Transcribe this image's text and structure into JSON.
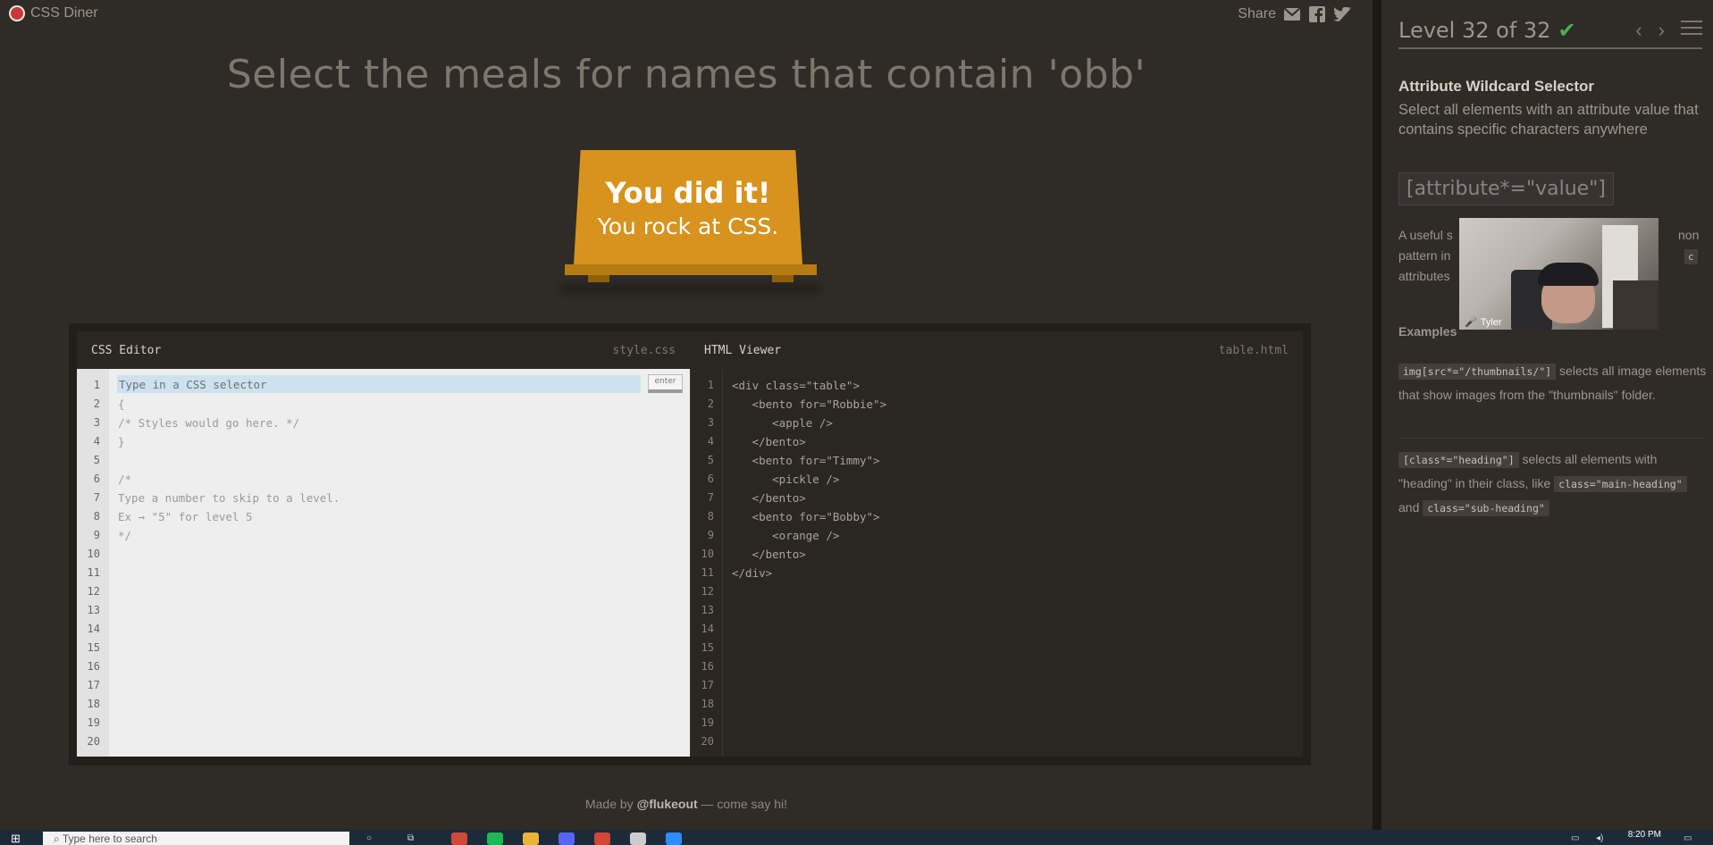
{
  "app": {
    "title": "CSS Diner"
  },
  "share": {
    "label": "Share",
    "icons": [
      "email-icon",
      "facebook-icon",
      "twitter-icon"
    ]
  },
  "order": "Select the meals for names that contain 'obb'",
  "table": {
    "line1": "You did it!",
    "line2": "You rock at CSS."
  },
  "editor": {
    "css_title": "CSS Editor",
    "css_file": "style.css",
    "html_title": "HTML Viewer",
    "html_file": "table.html",
    "input_placeholder": "Type in a CSS selector",
    "enter_label": "enter",
    "css_lines": [
      "{",
      "/* Styles would go here. */",
      "}",
      "",
      "/*",
      "Type a number to skip to a level.",
      "Ex → \"5\" for level 5",
      "*/"
    ],
    "html_lines": [
      "<div class=\"table\">",
      "   <bento for=\"Robbie\">",
      "      <apple />",
      "   </bento>",
      "   <bento for=\"Timmy\">",
      "      <pickle />",
      "   </bento>",
      "   <bento for=\"Bobby\">",
      "      <orange />",
      "   </bento>",
      "</div>"
    ],
    "line_count": 20
  },
  "footer": {
    "prefix": "Made by ",
    "handle": "@flukeout",
    "suffix": " — come say hi!"
  },
  "sidebar": {
    "level_title": "Level 32 of 32",
    "completed": true,
    "level_progress_fraction": 1.0,
    "selector_name": "Attribute Wildcard Selector",
    "title": "Select all elements with an attribute value that contains specific characters anywhere",
    "syntax": "[attribute*=\"value\"]",
    "hint_text_visible": [
      "A useful s",
      "non",
      "pattern in",
      "c",
      "attributes"
    ],
    "examples_title": "Examples",
    "example1_code": "img[src*=\"/thumbnails/\"]",
    "example1_text": " selects all image elements that show images from the \"thumbnails\" folder.",
    "example2_code": "[class*=\"heading\"]",
    "example2_text1": " selects all elements with \"heading\" in their class, like ",
    "example2_code2": "class=\"main-heading\"",
    "example2_and": " and ",
    "example2_code3": "class=\"sub-heading\""
  },
  "webcam": {
    "name": "Tyler"
  },
  "taskbar": {
    "search_placeholder": "Type here to search",
    "clock": "8:20 PM",
    "app_colors": [
      "#d04a3a",
      "#1db954",
      "#e8b43a",
      "#5865f2",
      "#d44638",
      "#cccccc",
      "#2d8cff"
    ]
  }
}
